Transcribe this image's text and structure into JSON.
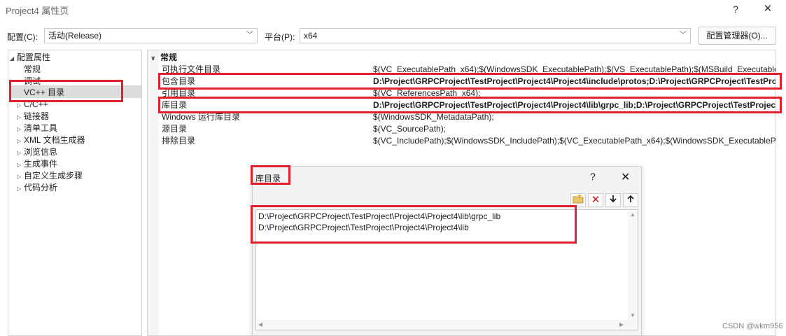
{
  "window": {
    "title": "Project4 属性页",
    "help": "?",
    "close": "✕"
  },
  "toolbar": {
    "config_label": "配置(C):",
    "config_value": "活动(Release)",
    "platform_label": "平台(P):",
    "platform_value": "x64",
    "manager_button": "配置管理器(O)..."
  },
  "tree": {
    "items": [
      {
        "label": "配置属性",
        "expander": "◢"
      },
      {
        "label": "常规",
        "expander": ""
      },
      {
        "label": "调试",
        "expander": ""
      },
      {
        "label": "VC++ 目录",
        "expander": ""
      },
      {
        "label": "C/C++",
        "expander": "▷"
      },
      {
        "label": "链接器",
        "expander": "▷"
      },
      {
        "label": "清单工具",
        "expander": "▷"
      },
      {
        "label": "XML 文档生成器",
        "expander": "▷"
      },
      {
        "label": "浏览信息",
        "expander": "▷"
      },
      {
        "label": "生成事件",
        "expander": "▷"
      },
      {
        "label": "自定义生成步骤",
        "expander": "▷"
      },
      {
        "label": "代码分析",
        "expander": "▷"
      }
    ]
  },
  "grid": {
    "category": "常规",
    "rows": [
      {
        "name": "可执行文件目录",
        "value": "$(VC_ExecutablePath_x64);$(WindowsSDK_ExecutablePath);$(VS_ExecutablePath);$(MSBuild_ExecutablePath)",
        "bold": false
      },
      {
        "name": "包含目录",
        "value": "D:\\Project\\GRPCProject\\TestProject\\Project4\\Project4\\include\\protos;D:\\Project\\GRPCProject\\TestProject",
        "bold": true
      },
      {
        "name": "引用目录",
        "value": "$(VC_ReferencesPath_x64);",
        "bold": false
      },
      {
        "name": "库目录",
        "value": "D:\\Project\\GRPCProject\\TestProject\\Project4\\Project4\\lib\\grpc_lib;D:\\Project\\GRPCProject\\TestProject",
        "bold": true
      },
      {
        "name": "Windows 运行库目录",
        "value": "$(WindowsSDK_MetadataPath);",
        "bold": false
      },
      {
        "name": "源目录",
        "value": "$(VC_SourcePath);",
        "bold": false
      },
      {
        "name": "排除目录",
        "value": "$(VC_IncludePath);$(WindowsSDK_IncludePath);$(VC_ExecutablePath_x64);$(WindowsSDK_ExecutablePath)",
        "bold": false
      }
    ]
  },
  "dialog": {
    "title": "库目录",
    "help": "?",
    "close": "✕",
    "lines": [
      "D:\\Project\\GRPCProject\\TestProject\\Project4\\Project4\\lib\\grpc_lib",
      "D:\\Project\\GRPCProject\\TestProject\\Project4\\Project4\\lib"
    ]
  },
  "watermark": "CSDN @wkm956",
  "colors": {
    "highlight": "#e0202a",
    "selection": "#dcdcdc"
  }
}
